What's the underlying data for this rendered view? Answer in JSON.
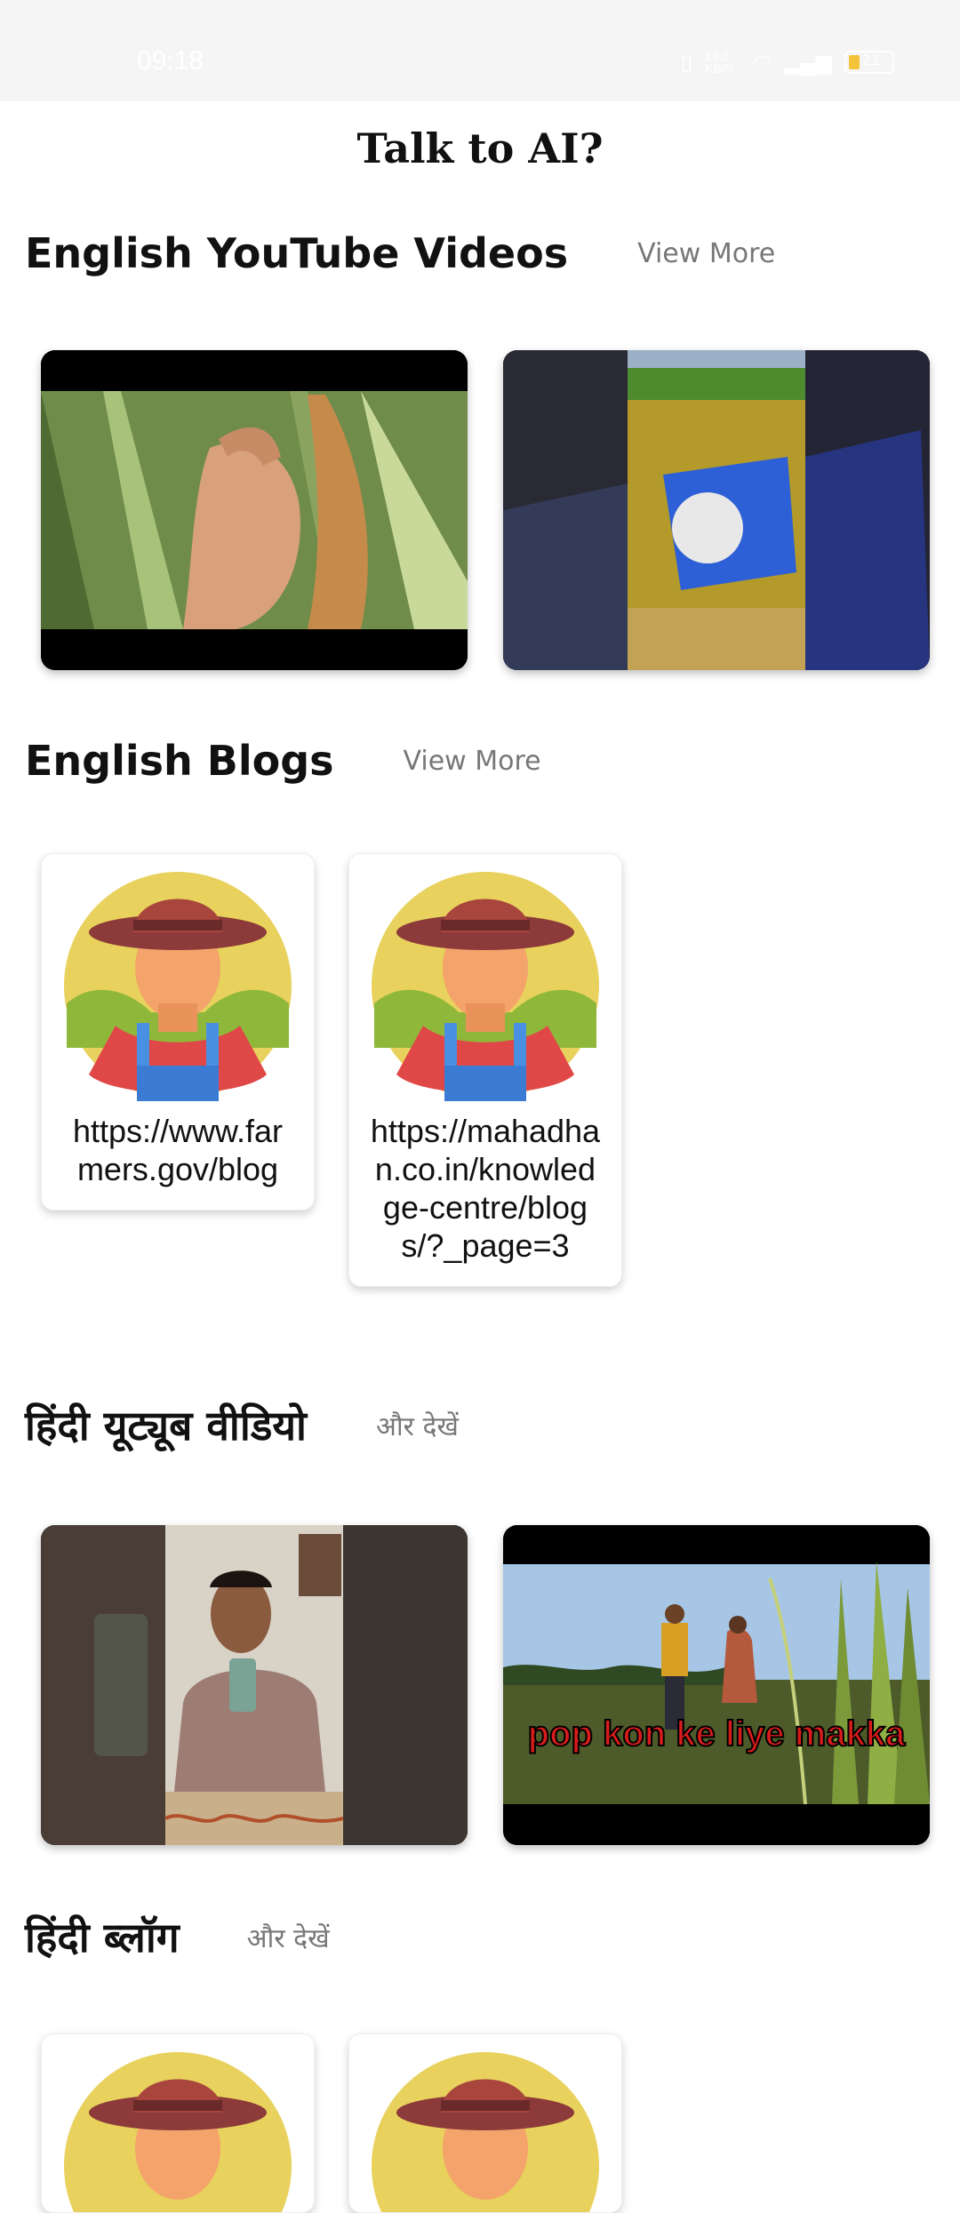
{
  "status_bar": {
    "time": "09:18",
    "net_speed": "13.0 KB/S",
    "battery": "21"
  },
  "app": {
    "title": "Talk to AI?"
  },
  "sections": {
    "english_videos": {
      "title": "English YouTube Videos",
      "view_more": "View More"
    },
    "english_blogs": {
      "title": "English Blogs",
      "view_more": "View More",
      "items": [
        {
          "url": "https://www.farmers.gov/blog"
        },
        {
          "url": "https://mahadhan.co.in/knowledge-centre/blogs/?_page=3"
        }
      ]
    },
    "hindi_videos": {
      "title": "हिंदी यूट्यूब वीडियो",
      "view_more": "और देखें",
      "videos": [
        {
          "caption": ""
        },
        {
          "caption": "pop kon ke liye makka"
        }
      ]
    },
    "hindi_blogs": {
      "title": "हिंदी ब्लॉग",
      "view_more": "और देखें"
    }
  },
  "icons": {
    "blog_avatar": "farmer-avatar-icon"
  },
  "colors": {
    "status_bar_bg": "#f5f5f5",
    "caption_red": "#d81b1b"
  }
}
